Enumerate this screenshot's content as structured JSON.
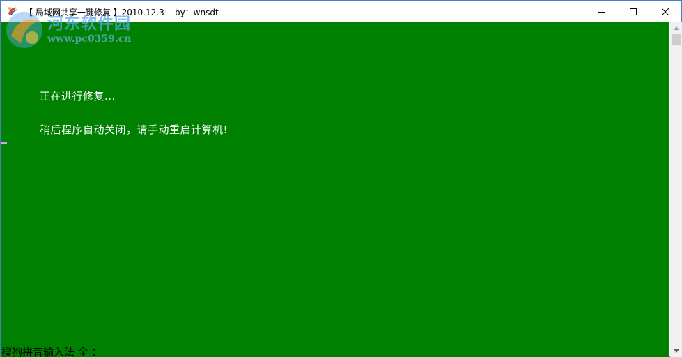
{
  "window": {
    "title": "【 局域网共享一键修复 】2010.12.3    by：wnsdt"
  },
  "watermark": {
    "site_name": "河东软件园",
    "url": "www.pc0359.cn"
  },
  "caption_buttons": {
    "minimize_icon": "minimize-icon",
    "maximize_icon": "maximize-icon",
    "close_icon": "close-icon"
  },
  "console": {
    "background_color": "#008000",
    "text_color": "#ffffff",
    "lines": [
      "正在进行修复...",
      "稍后程序自动关闭，请手动重启计算机!"
    ],
    "ime_status": "搜狗拼音输入法 全 ："
  },
  "colors": {
    "window_border": "#4a7fbf",
    "cursor_mark": "#d8a0e8"
  }
}
